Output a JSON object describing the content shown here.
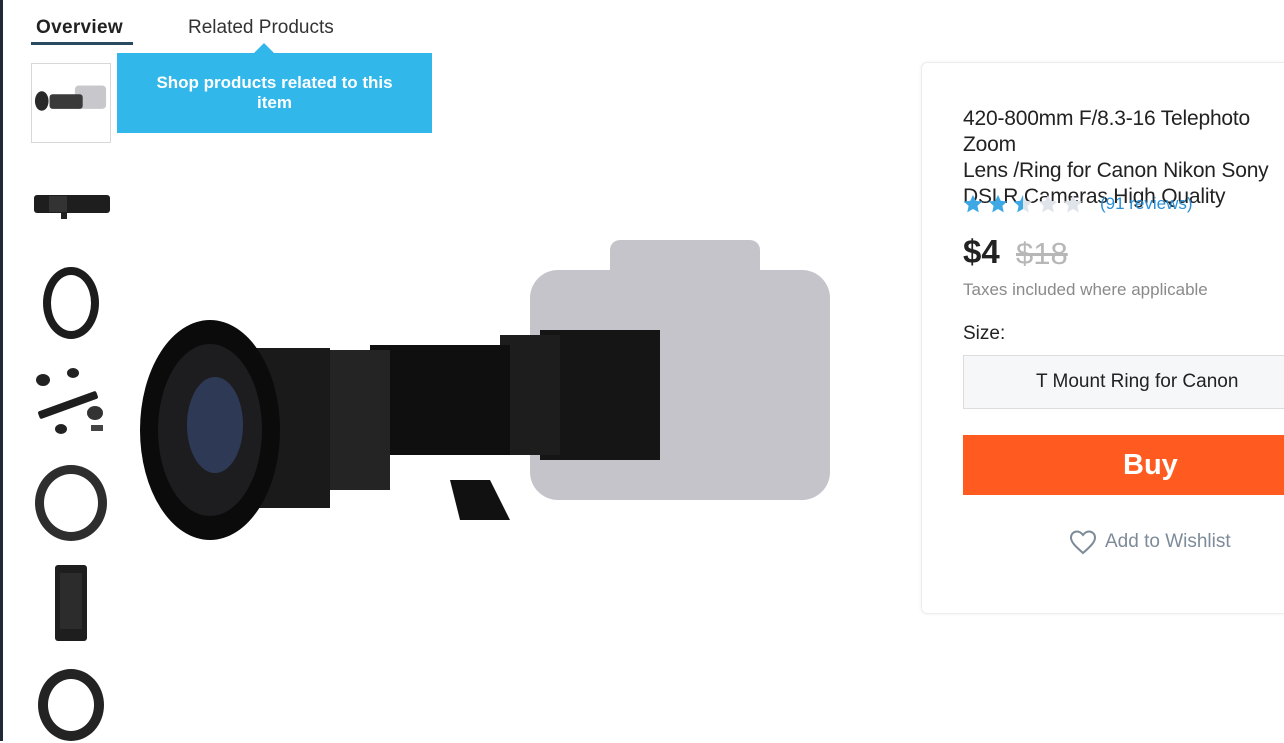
{
  "tabs": {
    "overview": "Overview",
    "related": "Related Products"
  },
  "tooltip": {
    "text": "Shop products related to this item",
    "color": "#31b7ea"
  },
  "thumbnails": [
    {
      "name": "thumb-lens-on-camera",
      "selected": true
    },
    {
      "name": "thumb-lens-side"
    },
    {
      "name": "thumb-t-ring"
    },
    {
      "name": "thumb-package-contents"
    },
    {
      "name": "thumb-t-ring-2"
    },
    {
      "name": "thumb-lens-barrel"
    },
    {
      "name": "thumb-t-ring-3"
    }
  ],
  "product": {
    "title": "420-800mm F/8.3-16 Telephoto Zoom\nLens /Ring for Canon Nikon Sony\nDSLR Cameras High Quality",
    "rating": 2.5,
    "rating_max": 5,
    "reviews": "(91 reviews)",
    "price": "$4",
    "old_price": "$18",
    "taxes": "Taxes included where applicable",
    "size_label": "Size:",
    "size_option": "T Mount Ring for Canon",
    "buy_label": "Buy",
    "wishlist_label": "Add to Wishlist",
    "star_color": "#3ea8e5",
    "buy_color": "#ff5a1f"
  }
}
